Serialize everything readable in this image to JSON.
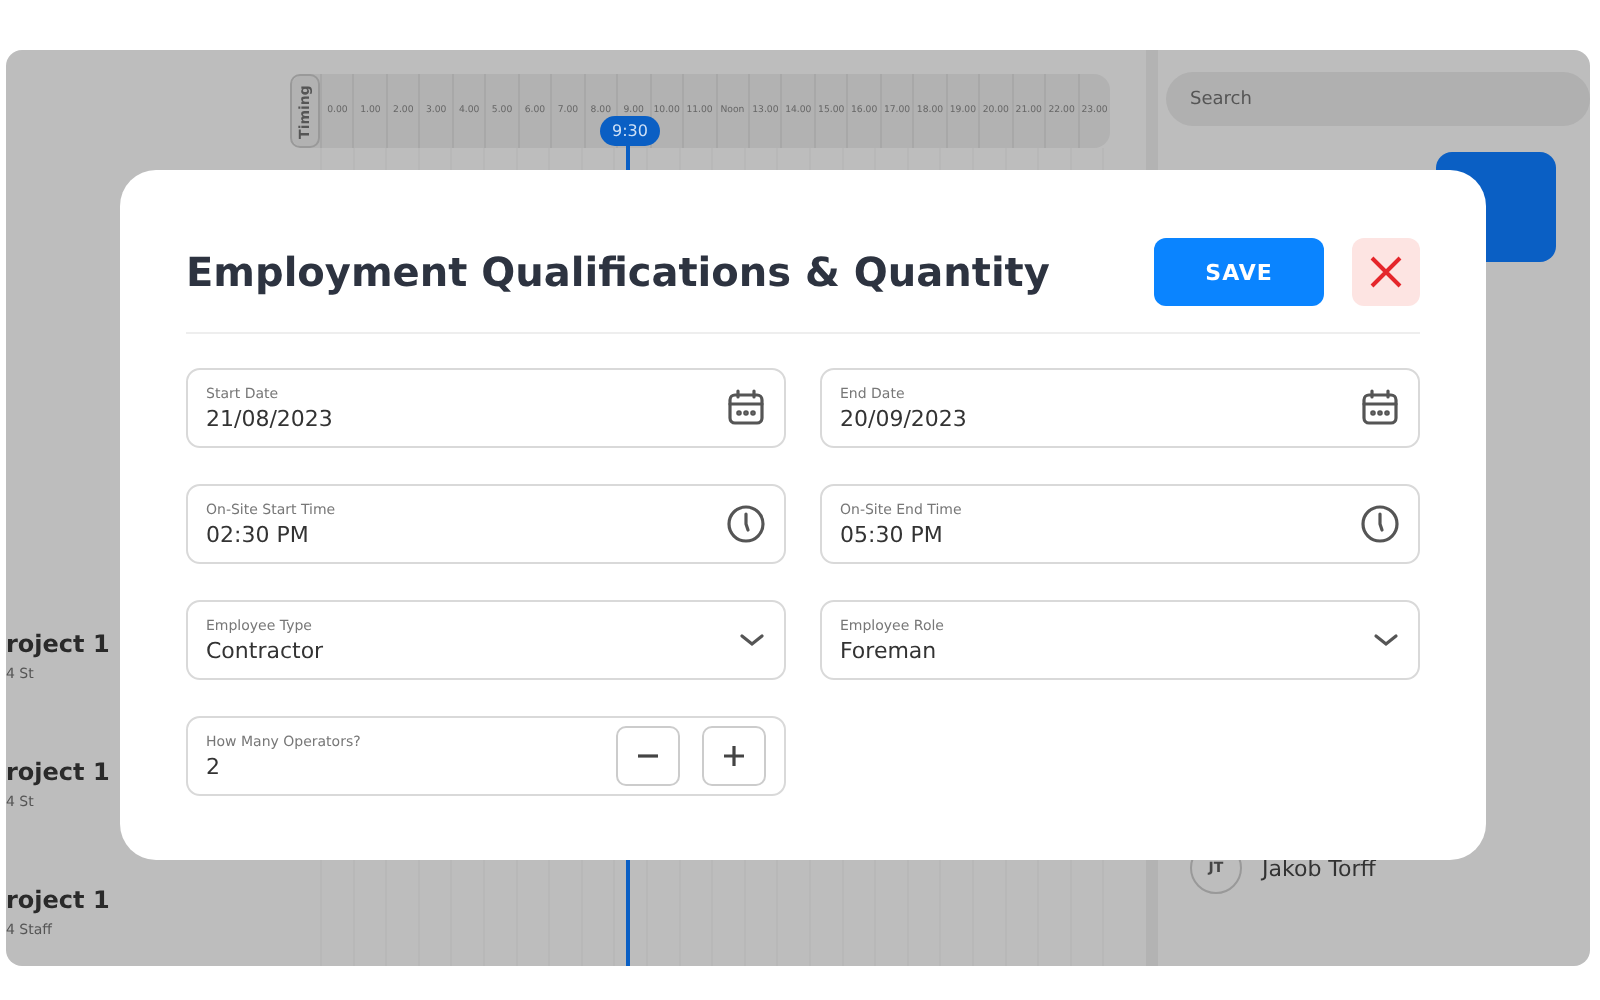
{
  "background": {
    "timing_label": "Timing",
    "hours": [
      "0.00",
      "1.00",
      "2.00",
      "3.00",
      "4.00",
      "5.00",
      "6.00",
      "7.00",
      "8.00",
      "9.00",
      "10.00",
      "11.00",
      "Noon",
      "13.00",
      "14.00",
      "15.00",
      "16.00",
      "17.00",
      "18.00",
      "19.00",
      "20.00",
      "21.00",
      "22.00",
      "23.00"
    ],
    "now_marker": "9:30",
    "projects": [
      {
        "title": "roject 1",
        "meta": "4 St"
      },
      {
        "title": "roject 1",
        "meta": "4 St"
      },
      {
        "title": "roject 1",
        "meta": "4 Staff"
      }
    ],
    "search": {
      "placeholder": "Search"
    },
    "people": [
      {
        "initials": "JT",
        "name": "Jakob Torff"
      }
    ]
  },
  "dialog": {
    "title": "Employment Qualifications & Quantity",
    "save": "SAVE",
    "fields": [
      {
        "kind": "date",
        "label": "Start Date",
        "value": "21/08/2023"
      },
      {
        "kind": "date",
        "label": "End Date",
        "value": "20/09/2023"
      },
      {
        "kind": "time",
        "label": "On-Site Start Time",
        "value": "02:30 PM"
      },
      {
        "kind": "time",
        "label": "On-Site End Time",
        "value": "05:30 PM"
      },
      {
        "kind": "select",
        "label": "Employee Type",
        "value": "Contractor"
      },
      {
        "kind": "select",
        "label": "Employee Role",
        "value": "Foreman"
      },
      {
        "kind": "stepper",
        "label": "How Many Operators?",
        "value": "2"
      }
    ]
  }
}
